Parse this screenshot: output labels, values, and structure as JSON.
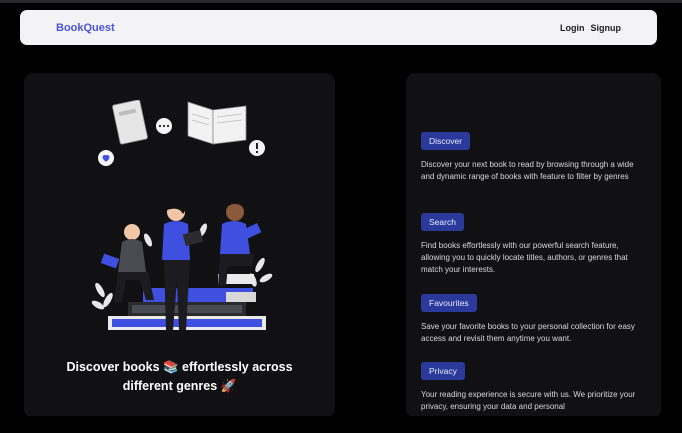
{
  "navbar": {
    "brand": "BookQuest",
    "links": [
      "Login",
      "Signup"
    ]
  },
  "hero": {
    "title_line1": "Discover books 📚 effortlessly across",
    "title_line2": "different genres 🚀"
  },
  "features": [
    {
      "label": "Discover",
      "description": "Discover your next book to read by browsing through a wide and dynamic range of books with feature to filter by genres"
    },
    {
      "label": "Search",
      "description": "Find books effortlessly with our powerful search feature, allowing you to quickly locate titles, authors, or genres that match your interests."
    },
    {
      "label": "Favourites",
      "description": "Save your favorite books to your personal collection for easy access and revisit them anytime you want."
    },
    {
      "label": "Privacy",
      "description": "Your reading experience is secure with us. We prioritize your privacy, ensuring your data and personal"
    }
  ],
  "colors": {
    "accent": "#4a55d6",
    "pill_bg": "#2b3a9a",
    "card_bg": "#111113",
    "illustration_blue": "#3f4fe0"
  },
  "illustration": "people-reading-books-illustration"
}
